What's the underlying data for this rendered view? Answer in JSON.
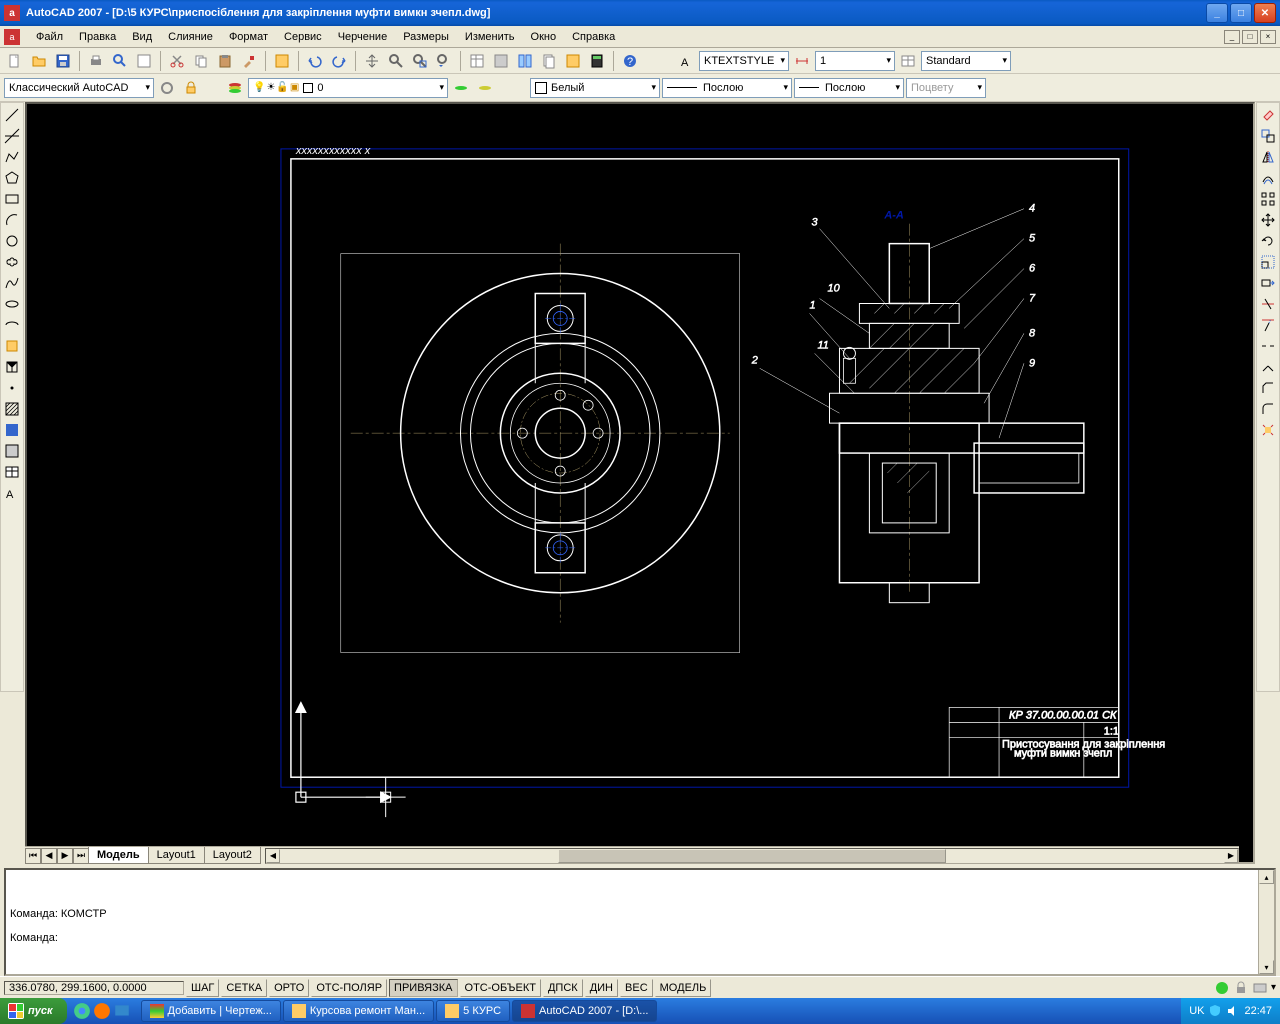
{
  "window": {
    "title": "AutoCAD 2007 - [D:\\5 КУРС\\приспосіблення для закріплення муфти вимкн зчепл.dwg]"
  },
  "menu": {
    "items": [
      "Файл",
      "Правка",
      "Вид",
      "Слияние",
      "Формат",
      "Сервис",
      "Черчение",
      "Размеры",
      "Изменить",
      "Окно",
      "Справка"
    ]
  },
  "toolbar": {
    "workspace": "Классический AutoCAD",
    "layer": "0",
    "textstyle": "KTEXTSTYLE",
    "dimscale": "1",
    "dimstyle": "Standard",
    "color": "Белый",
    "linetype": "Послою",
    "lineweight": "Послою",
    "plotstyle": "Поцвету"
  },
  "layout": {
    "tabs": [
      "Модель",
      "Layout1",
      "Layout2"
    ],
    "active": 0
  },
  "command": {
    "line1": "Команда: КОМСТР",
    "prompt": "Команда:"
  },
  "status": {
    "coords": "336.0780, 299.1600, 0.0000",
    "buttons": [
      "ШАГ",
      "СЕТКА",
      "ОРТО",
      "ОТС-ПОЛЯР",
      "ПРИВЯЗКА",
      "ОТС-ОБЪЕКТ",
      "ДПСК",
      "ДИН",
      "ВЕС",
      "МОДЕЛЬ"
    ],
    "active": [
      4
    ]
  },
  "taskbar": {
    "start": "пуск",
    "tasks": [
      {
        "label": "Добавить | Чертеж...",
        "icon": "chrome"
      },
      {
        "label": "Курсова ремонт Ман...",
        "icon": "folder"
      },
      {
        "label": "5 КУРС",
        "icon": "folder"
      },
      {
        "label": "AutoCAD 2007 - [D:\\...",
        "icon": "acad",
        "active": true
      }
    ],
    "lang": "UK",
    "time": "22:47"
  },
  "drawing": {
    "section_label": "A-A",
    "callouts": [
      "1",
      "2",
      "3",
      "4",
      "5",
      "6",
      "7",
      "8",
      "9",
      "10",
      "11"
    ],
    "title_block_code": "КР 37.00.00.00.01 СК"
  }
}
